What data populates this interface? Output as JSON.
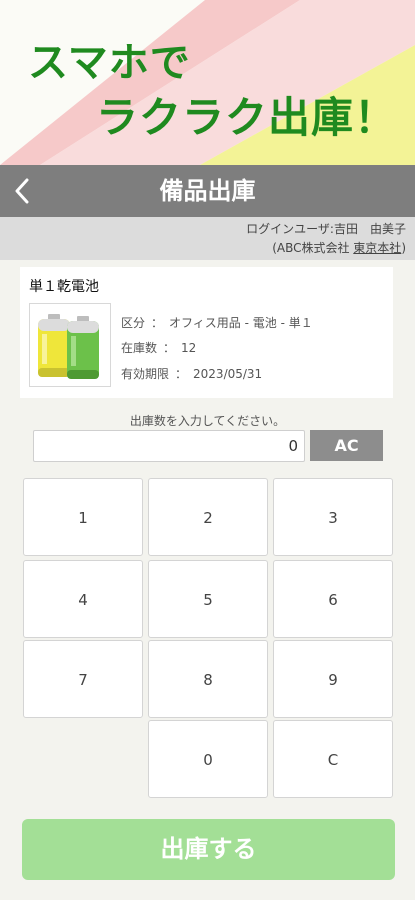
{
  "banner": {
    "line1": "スマホで",
    "line2": "ラクラク出庫！"
  },
  "header": {
    "title": "備品出庫",
    "back_icon": "chevron-left-icon"
  },
  "user": {
    "login_label": "ログインユーザ:",
    "name": "吉田　由美子",
    "company_prefix": "(ABC株式会社 ",
    "branch": "東京本社",
    "company_suffix": ")"
  },
  "item": {
    "name": "単１乾電池",
    "image_icon": "battery-icon",
    "category_label": "区分",
    "category_value": "オフィス用品 - 電池 - 単１",
    "stock_label": "在庫数",
    "stock_value": "12",
    "expiry_label": "有効期限",
    "expiry_value": "2023/05/31",
    "separator": "："
  },
  "quantity": {
    "prompt": "出庫数を入力してください。",
    "value": "0",
    "clear_all_label": "AC"
  },
  "keypad": {
    "k1": "1",
    "k2": "2",
    "k3": "3",
    "k4": "4",
    "k5": "5",
    "k6": "6",
    "k7": "7",
    "k8": "8",
    "k9": "9",
    "k0": "0",
    "kC": "C"
  },
  "submit": {
    "label": "出庫する"
  },
  "colors": {
    "brand_green": "#1f8a1f",
    "header_gray": "#7e7e7e",
    "submit_green": "#a3df96"
  }
}
